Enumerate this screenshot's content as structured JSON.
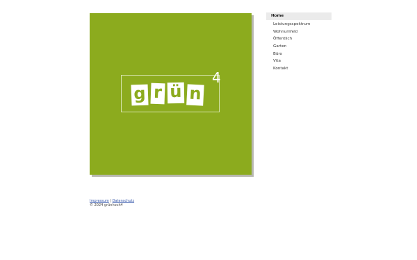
{
  "logo": {
    "letters": [
      "g",
      "r",
      "ü",
      "n"
    ],
    "superscript": "4",
    "background_color": "#8cab1e"
  },
  "nav": {
    "items": [
      {
        "label": "Home",
        "active": true
      },
      {
        "label": "Leistungsspektrum",
        "active": false
      },
      {
        "label": "Wohnumfeld",
        "active": false
      },
      {
        "label": "Öffentlich",
        "active": false
      },
      {
        "label": "Garten",
        "active": false
      },
      {
        "label": "Büro",
        "active": false
      },
      {
        "label": "Vita",
        "active": false
      },
      {
        "label": "Kontakt",
        "active": false
      }
    ]
  },
  "footer": {
    "impressum_label": "Impressum",
    "separator": "|",
    "datenschutz_label": "Datenschutz",
    "copyright": "© 2024 grünhoch4"
  }
}
